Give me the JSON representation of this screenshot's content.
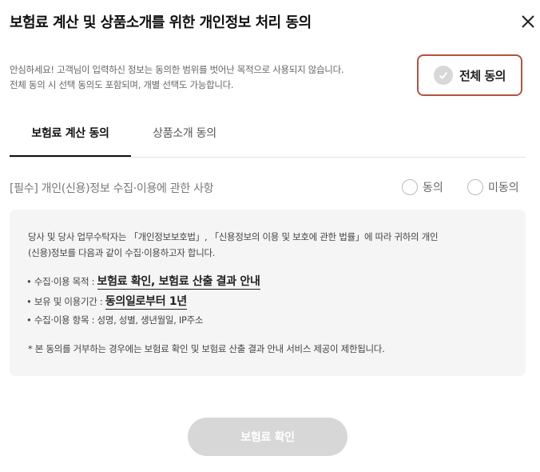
{
  "header": {
    "title": "보험료 계산 및 상품소개를 위한 개인정보 처리 동의",
    "close_icon": "close-icon"
  },
  "notice": {
    "line1": "안심하세요! 고객님이 입력하신 정보는 동의한 범위를 벗어난 목적으로 사용되지 않습니다.",
    "line2": "전체 동의 시 선택 동의도 포함되며, 개별 선택도 가능합니다."
  },
  "all_agree": {
    "label": "전체 동의",
    "icon": "check-circle-icon",
    "border_color": "#b5523f"
  },
  "tabs": [
    {
      "label": "보험료 계산 동의",
      "active": true
    },
    {
      "label": "상품소개 동의",
      "active": false
    }
  ],
  "section": {
    "title": "[필수] 개인(신용)정보 수집·이용에 관한 사항",
    "agree_label": "동의",
    "disagree_label": "미동의"
  },
  "panel": {
    "intro_line1": "당사 및 당사 업무수탁자는 「개인정보보호법」, 「신용정보의 이용 및 보호에 관한 법률」에 따라 귀하의 개인",
    "intro_line2": "(신용)정보를 다음과 같이 수집·이용하고자 합니다.",
    "items": [
      {
        "prefix": "• 수집·이용 목적 : ",
        "value": "보험료 확인, 보험료 산출 결과 안내",
        "highlight": true
      },
      {
        "prefix": "• 보유 및 이용기간 : ",
        "value": "동의일로부터 1년",
        "highlight": true
      },
      {
        "prefix": "• 수집·이용 항목 : ",
        "value": "성명, 성별, 생년월일, IP주소",
        "highlight": false
      }
    ],
    "footnote": "* 본 동의를 거부하는 경우에는 보험료 확인 및 보험료 산출 결과 안내 서비스 제공이 제한됩니다."
  },
  "footer": {
    "confirm_label": "보험료 확인"
  },
  "colors": {
    "accent_border": "#b5523f",
    "disabled_button": "#d7d7d7",
    "panel_bg": "#f5f5f5"
  }
}
